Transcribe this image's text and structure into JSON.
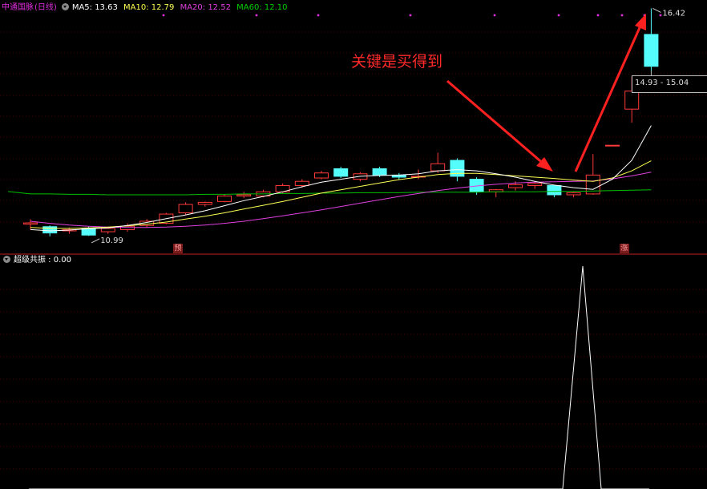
{
  "header": {
    "stock_name": "中通国脉",
    "period": "(日线)",
    "ma5": "MA5: 13.63",
    "ma10": "MA10: 12.79",
    "ma20": "MA20: 12.52",
    "ma60": "MA60: 12.10"
  },
  "annotation": {
    "text": "关键是买得到"
  },
  "labels": {
    "high": "16.42",
    "low": "10.99",
    "price_range": "14.93 - 15.04",
    "tag_left": "预",
    "tag_right": "涨"
  },
  "indicator": {
    "title": "超级共振 : 0.00"
  },
  "colors": {
    "up": "#ff3a3a",
    "down": "#54fcfc",
    "ma5": "#ffffff",
    "ma10": "#ffff54",
    "ma20": "#e040e0",
    "ma60": "#00c000",
    "arrow": "#ff2020"
  },
  "chart_data": [
    {
      "type": "candlestick",
      "title": "中通国脉 (日线)",
      "candles": [
        {
          "o": 11.28,
          "h": 11.4,
          "l": 11.15,
          "c": 11.31
        },
        {
          "o": 11.22,
          "h": 11.25,
          "l": 10.99,
          "c": 11.07
        },
        {
          "o": 11.12,
          "h": 11.2,
          "l": 11.05,
          "c": 11.15
        },
        {
          "o": 11.18,
          "h": 11.22,
          "l": 11.0,
          "c": 11.02
        },
        {
          "o": 11.1,
          "h": 11.22,
          "l": 11.05,
          "c": 11.18
        },
        {
          "o": 11.15,
          "h": 11.3,
          "l": 11.1,
          "c": 11.23
        },
        {
          "o": 11.25,
          "h": 11.4,
          "l": 11.2,
          "c": 11.35
        },
        {
          "o": 11.3,
          "h": 11.55,
          "l": 11.28,
          "c": 11.52
        },
        {
          "o": 11.55,
          "h": 11.8,
          "l": 11.5,
          "c": 11.75
        },
        {
          "o": 11.75,
          "h": 11.82,
          "l": 11.7,
          "c": 11.8
        },
        {
          "o": 11.82,
          "h": 11.98,
          "l": 11.8,
          "c": 11.95
        },
        {
          "o": 11.95,
          "h": 12.05,
          "l": 11.9,
          "c": 11.98
        },
        {
          "o": 11.95,
          "h": 12.1,
          "l": 11.92,
          "c": 12.05
        },
        {
          "o": 12.05,
          "h": 12.25,
          "l": 12.02,
          "c": 12.2
        },
        {
          "o": 12.2,
          "h": 12.35,
          "l": 12.15,
          "c": 12.3
        },
        {
          "o": 12.38,
          "h": 12.55,
          "l": 12.35,
          "c": 12.5
        },
        {
          "o": 12.6,
          "h": 12.65,
          "l": 12.38,
          "c": 12.42
        },
        {
          "o": 12.35,
          "h": 12.52,
          "l": 12.3,
          "c": 12.48
        },
        {
          "o": 12.6,
          "h": 12.65,
          "l": 12.4,
          "c": 12.45
        },
        {
          "o": 12.45,
          "h": 12.5,
          "l": 12.35,
          "c": 12.4
        },
        {
          "o": 12.4,
          "h": 12.58,
          "l": 12.35,
          "c": 12.42
        },
        {
          "o": 12.55,
          "h": 12.98,
          "l": 12.5,
          "c": 12.72
        },
        {
          "o": 12.8,
          "h": 12.85,
          "l": 12.3,
          "c": 12.42
        },
        {
          "o": 12.35,
          "h": 12.4,
          "l": 11.98,
          "c": 12.05
        },
        {
          "o": 12.05,
          "h": 12.12,
          "l": 11.92,
          "c": 12.1
        },
        {
          "o": 12.15,
          "h": 12.3,
          "l": 12.08,
          "c": 12.22
        },
        {
          "o": 12.2,
          "h": 12.28,
          "l": 12.12,
          "c": 12.25
        },
        {
          "o": 12.2,
          "h": 12.22,
          "l": 11.92,
          "c": 11.98
        },
        {
          "o": 11.98,
          "h": 12.05,
          "l": 11.92,
          "c": 12.03
        },
        {
          "o": 12.0,
          "h": 12.95,
          "l": 11.98,
          "c": 12.45
        },
        {
          "o": 13.15,
          "h": 13.16,
          "l": 13.14,
          "c": 13.16
        },
        {
          "o": 14.02,
          "h": 14.8,
          "l": 13.7,
          "c": 14.45
        },
        {
          "o": 15.8,
          "h": 16.42,
          "l": 14.93,
          "c": 15.04
        }
      ],
      "ma5": [
        11.15,
        11.12,
        11.14,
        11.17,
        11.19,
        11.25,
        11.32,
        11.41,
        11.5,
        11.6,
        11.72,
        11.84,
        11.94,
        12.05,
        12.17,
        12.28,
        12.35,
        12.42,
        12.44,
        12.45,
        12.48,
        12.55,
        12.58,
        12.55,
        12.48,
        12.4,
        12.3,
        12.21,
        12.15,
        12.11,
        12.35,
        12.8,
        13.63
      ],
      "ma10": [
        11.2,
        11.18,
        11.18,
        11.19,
        11.21,
        11.24,
        11.28,
        11.33,
        11.4,
        11.47,
        11.55,
        11.64,
        11.73,
        11.82,
        11.92,
        12.02,
        12.1,
        12.18,
        12.26,
        12.34,
        12.4,
        12.46,
        12.49,
        12.49,
        12.46,
        12.43,
        12.4,
        12.37,
        12.33,
        12.3,
        12.38,
        12.55,
        12.79
      ],
      "ma20": [
        11.35,
        11.3,
        11.26,
        11.23,
        11.21,
        11.2,
        11.2,
        11.21,
        11.23,
        11.26,
        11.3,
        11.35,
        11.41,
        11.48,
        11.55,
        11.62,
        11.7,
        11.78,
        11.86,
        11.94,
        12.01,
        12.08,
        12.14,
        12.19,
        12.23,
        12.26,
        12.28,
        12.29,
        12.3,
        12.31,
        12.36,
        12.43,
        12.52
      ],
      "ma60": [
        12.0,
        12.0,
        11.99,
        11.99,
        11.98,
        11.98,
        11.98,
        11.98,
        11.98,
        11.99,
        11.99,
        12.0,
        12.0,
        12.01,
        12.01,
        12.02,
        12.02,
        12.03,
        12.03,
        12.03,
        12.04,
        12.04,
        12.04,
        12.04,
        12.05,
        12.05,
        12.05,
        12.06,
        12.06,
        12.07,
        12.08,
        12.09,
        12.1
      ],
      "high_label": 16.42,
      "low_label": 10.99,
      "range_label": "14.93 - 15.04"
    },
    {
      "type": "line",
      "title": "超级共振 : 0.00",
      "values": [
        0,
        0,
        0,
        0,
        0,
        0,
        0,
        0,
        0,
        0,
        0,
        0,
        0,
        0,
        0,
        0,
        0,
        0,
        0,
        0,
        0,
        0,
        0,
        0,
        0,
        0,
        0,
        0,
        0,
        0,
        1,
        0,
        0
      ]
    }
  ]
}
